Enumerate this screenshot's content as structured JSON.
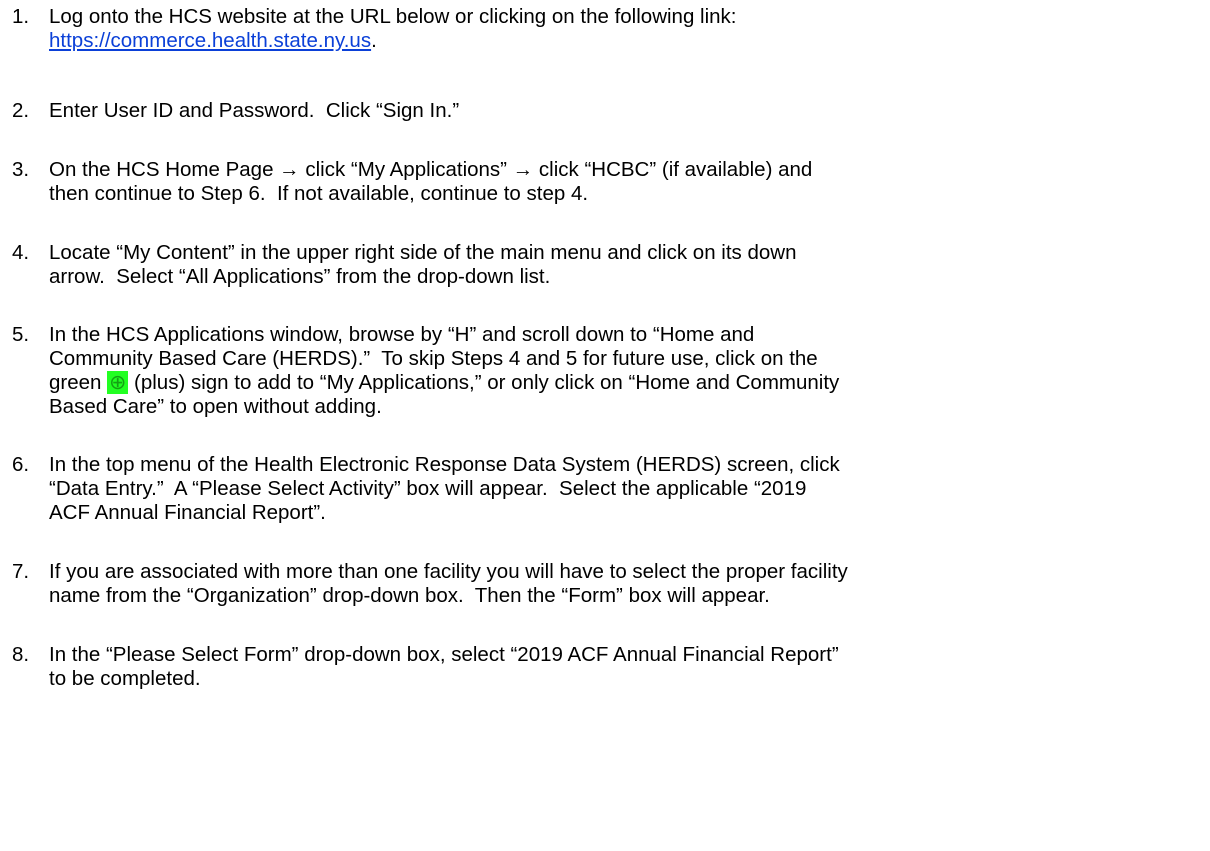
{
  "steps": [
    {
      "num": "1.",
      "lines": [
        "Log onto the HCS website at the URL below or clicking on the following link:"
      ],
      "link_text": "https://commerce.health.state.ny.us",
      "link_suffix": "."
    },
    {
      "num": "2.",
      "lines": [
        "Enter User ID and Password.  Click “Sign In.”"
      ]
    },
    {
      "num": "3.",
      "lines": [
        "On the HCS Home Page → click “My Applications” → click “HCBC” (if available) and",
        "then continue to Step 6.  If not available, continue to step 4."
      ]
    },
    {
      "num": "4.",
      "lines": [
        "Locate “My Content” in the upper right side of the main menu and click on its down",
        "arrow.  Select “All Applications” from the drop-down list."
      ]
    },
    {
      "num": "5.",
      "lines": [
        "In the HCS Applications window, browse by “H” and scroll down to “Home and",
        "Community Based Care (HERDS).”  To skip Steps 4 and 5 for future use, click on the"
      ],
      "line3_before": "green ",
      "plus_glyph": "⊕",
      "line3_after": " (plus) sign to add to “My Applications,” or only click on “Home and Community",
      "line4": "Based Care” to open without adding."
    },
    {
      "num": "6.",
      "lines": [
        "In the top menu of the Health Electronic Response Data System (HERDS) screen, click",
        "“Data Entry.”  A “Please Select Activity” box will appear.  Select the applicable “2019",
        "ACF Annual Financial Report”."
      ]
    },
    {
      "num": "7.",
      "lines": [
        "If you are associated with more than one facility you will have to select the proper facility",
        "name from the “Organization” drop-down box.  Then the “Form” box will appear."
      ]
    },
    {
      "num": "8.",
      "lines": [
        "In the “Please Select Form” drop-down box, select “2019 ACF Annual Financial Report”",
        "to be completed."
      ]
    }
  ],
  "colors": {
    "link": "#0b40d8",
    "highlight": "#22ff22",
    "plus": "#14a014"
  }
}
